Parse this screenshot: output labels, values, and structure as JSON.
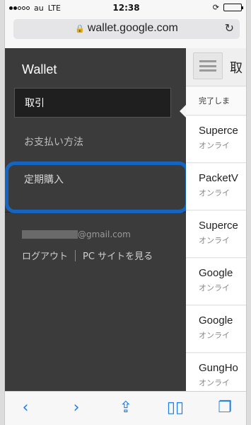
{
  "status_bar": {
    "carrier": "au",
    "network": "LTE",
    "time": "12:38"
  },
  "browser": {
    "url": "wallet.google.com"
  },
  "side_menu": {
    "title": "Wallet",
    "items": [
      {
        "label": "取引"
      },
      {
        "label": "お支払い方法"
      },
      {
        "label": "定期購入"
      }
    ],
    "email_suffix": "@gmail.com",
    "logout": "ログアウト",
    "pc_site": "PC サイトを見る"
  },
  "content": {
    "header_title": "取",
    "status_text": "完了しま",
    "rows": [
      {
        "name": "Superce",
        "sub": "オンライ"
      },
      {
        "name": "PacketV",
        "sub": "オンライ"
      },
      {
        "name": "Superce",
        "sub": "オンライ"
      },
      {
        "name": "Google",
        "sub": "オンライ"
      },
      {
        "name": "Google",
        "sub": "オンライ"
      },
      {
        "name": "GungHo",
        "sub": "オンライ"
      }
    ]
  },
  "colors": {
    "highlight": "#1565c0",
    "menu_bg": "#3b3b3b",
    "toolbar_icon": "#1a7ee6"
  },
  "icons": [
    "lock-icon",
    "reload-icon",
    "hamburger-icon",
    "back-icon",
    "forward-icon",
    "share-icon",
    "bookmarks-icon",
    "tabs-icon"
  ]
}
